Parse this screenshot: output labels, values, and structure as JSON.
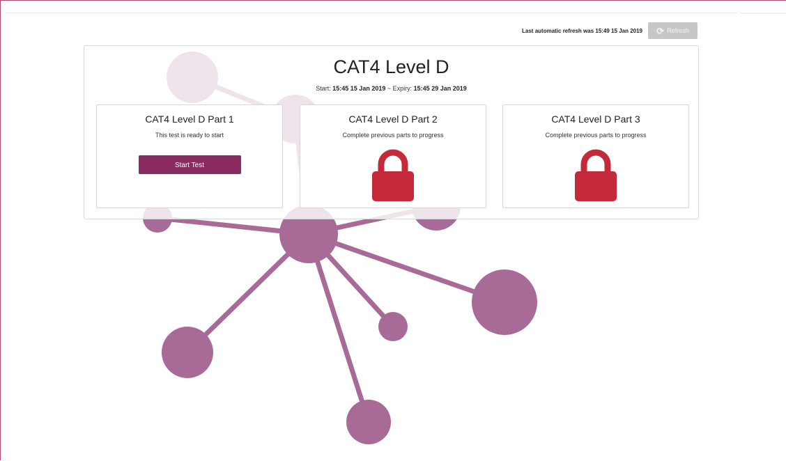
{
  "header": {
    "refresh_text": "Last automatic refresh was 15:49 15 Jan 2019",
    "refresh_button_label": "Refresh",
    "refresh_icon": "refresh-icon"
  },
  "test": {
    "title": "CAT4 Level D",
    "start_label": "Start:",
    "start_value": "15:45 15 Jan 2019",
    "separator": "~",
    "expiry_label": "Expiry:",
    "expiry_value": "15:45 29 Jan 2019"
  },
  "parts": [
    {
      "title": "CAT4 Level D Part 1",
      "status": "This test is ready to start",
      "button_label": "Start Test",
      "locked": false
    },
    {
      "title": "CAT4 Level D Part 2",
      "status": "Complete previous parts to progress",
      "icon": "lock-icon",
      "locked": true
    },
    {
      "title": "CAT4 Level D Part 3",
      "status": "Complete previous parts to progress",
      "icon": "lock-icon",
      "locked": true
    }
  ],
  "colors": {
    "accent": "#8a2b62",
    "lock": "#c52a3a",
    "network": "#a86a97",
    "refresh_button": "#c7c7c7"
  }
}
